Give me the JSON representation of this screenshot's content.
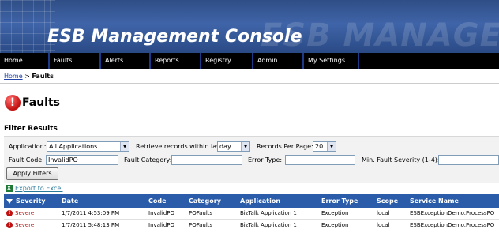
{
  "app": {
    "title": "ESB Management Console",
    "ghost_title": "ESB MANAGEMENT CON"
  },
  "nav": [
    "Home",
    "Faults",
    "Alerts",
    "Reports",
    "Registry",
    "Admin",
    "My Settings"
  ],
  "breadcrumb": {
    "home": "Home",
    "sep": ">",
    "current": "Faults"
  },
  "page": {
    "title": "Faults",
    "icon": "error-icon"
  },
  "filters": {
    "title": "Filter Results",
    "application_label": "Application:",
    "application_value": "All Applications",
    "retrieve_label": "Retrieve records within last",
    "retrieve_value": "day",
    "per_page_label": "Records Per Page:",
    "per_page_value": "20",
    "fault_code_label": "Fault Code:",
    "fault_code_value": "InvalidPO",
    "fault_category_label": "Fault Category:",
    "fault_category_value": "",
    "error_type_label": "Error Type:",
    "error_type_value": "",
    "min_severity_label": "Min. Fault Severity (1-4):",
    "min_severity_value": "",
    "apply_label": "Apply Filters"
  },
  "export": {
    "label": "Export to Excel",
    "icon": "excel-icon"
  },
  "table": {
    "columns": [
      "Severity",
      "Date",
      "Code",
      "Category",
      "Application",
      "Error Type",
      "Scope",
      "Service Name"
    ],
    "rows": [
      [
        "Severe",
        "1/7/2011 4:53:09 PM",
        "InvalidPO",
        "POFaults",
        "BizTalk Application 1",
        "Exception",
        "local",
        "ESBExceptionDemo.ProcessPO"
      ],
      [
        "Severe",
        "1/7/2011 5:48:13 PM",
        "InvalidPO",
        "POFaults",
        "BizTalk Application 1",
        "Exception",
        "local",
        "ESBExceptionDemo.ProcessPO"
      ]
    ]
  },
  "colors": {
    "banner": "#3f64a8",
    "nav": "#000000",
    "table_header": "#2a5caa",
    "severe": "#c01010"
  }
}
